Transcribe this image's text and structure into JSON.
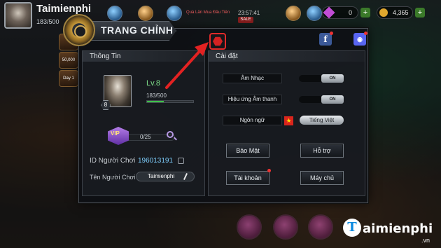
{
  "hud": {
    "player_name": "Taimienphi",
    "player_exp": "183/500",
    "event_text": "Quà Lân Mua Đầu Tiên",
    "event_time": "23:57:41",
    "event_badge": "SALE",
    "currency_gems": "0",
    "currency_coins": "4,365",
    "side_label": "Day 1",
    "side_value": "50,000"
  },
  "dialog": {
    "title": "TRANG CHỈNH"
  },
  "info": {
    "header": "Thông Tin",
    "level": "Lv.8",
    "level_badge": "8",
    "exp": "183/500",
    "exp_fraction": 0.366,
    "vip_label": "VIP",
    "vip_progress": "0/25",
    "id_label": "ID Người Chơi",
    "id_value": "196013191",
    "name_label": "Tên Người Chơi",
    "name_value": "Taimienphi"
  },
  "settings": {
    "header": "Cài đặt",
    "music_label": "Âm Nhạc",
    "music_state": "ON",
    "sound_label": "Hiệu ứng Âm thanh",
    "sound_state": "ON",
    "language_label": "Ngôn ngữ",
    "flag_symbol": "★",
    "language_value": "Tiếng Việt",
    "security_button": "Bảo Mật",
    "support_button": "Hỗ trợ",
    "account_button": "Tài khoản",
    "server_button": "Máy chủ"
  },
  "social": {
    "facebook": "f",
    "discord": "◉"
  },
  "watermark": {
    "letter": "T",
    "text": "aimienphi",
    "suffix": ".vn"
  },
  "colors": {
    "accent_red": "#e02a2a",
    "level_green": "#7fe08a",
    "id_blue": "#7fd0ff"
  }
}
